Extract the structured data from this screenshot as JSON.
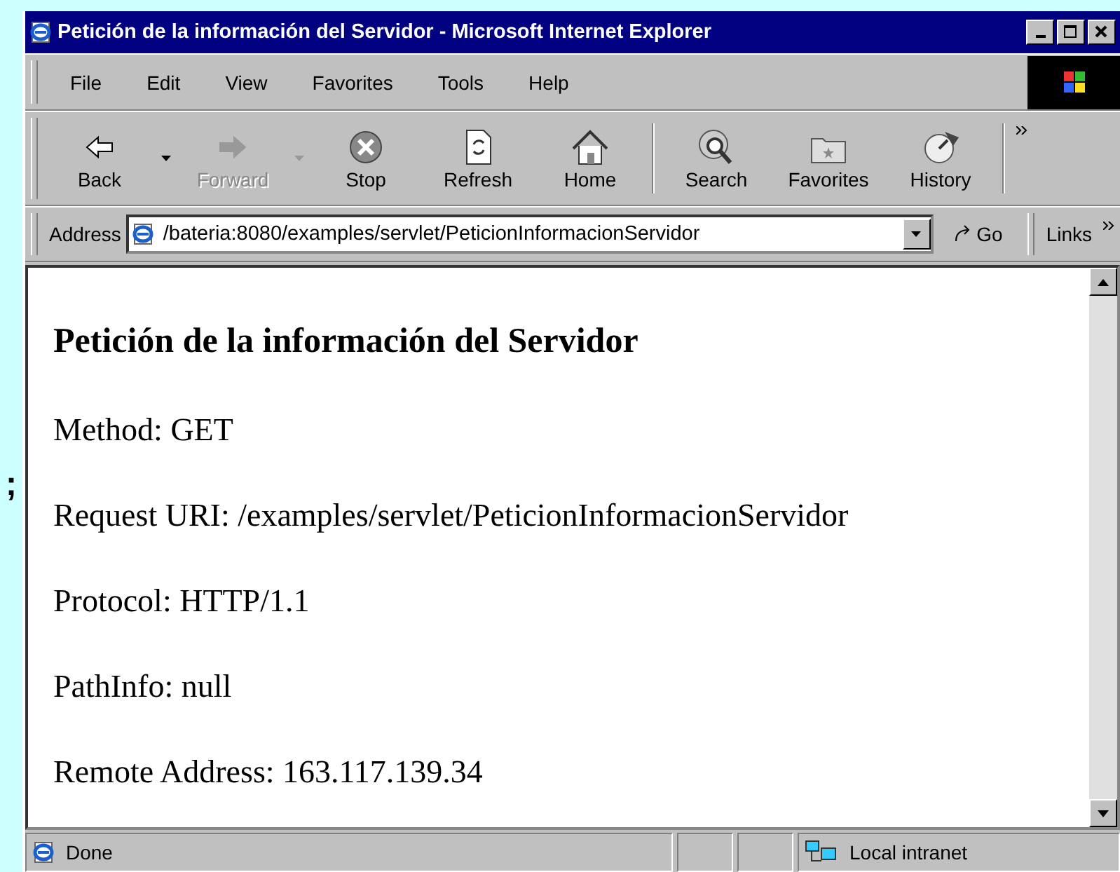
{
  "side_text": ";",
  "window": {
    "title": "Petición de la información del Servidor - Microsoft Internet Explorer"
  },
  "menu": [
    {
      "label": "File"
    },
    {
      "label": "Edit"
    },
    {
      "label": "View"
    },
    {
      "label": "Favorites"
    },
    {
      "label": "Tools"
    },
    {
      "label": "Help"
    }
  ],
  "toolbar": [
    {
      "kind": "back",
      "label": "Back",
      "disabled": false,
      "dropdown": true
    },
    {
      "kind": "forward",
      "label": "Forward",
      "disabled": true,
      "dropdown": true
    },
    {
      "kind": "stop",
      "label": "Stop",
      "disabled": false,
      "dropdown": false
    },
    {
      "kind": "refresh",
      "label": "Refresh",
      "disabled": false,
      "dropdown": false
    },
    {
      "kind": "home",
      "label": "Home",
      "disabled": false,
      "dropdown": false
    },
    {
      "kind": "separator"
    },
    {
      "kind": "search",
      "label": "Search",
      "disabled": false,
      "dropdown": false
    },
    {
      "kind": "favorites",
      "label": "Favorites",
      "disabled": false,
      "dropdown": false
    },
    {
      "kind": "history",
      "label": "History",
      "disabled": false,
      "dropdown": false
    }
  ],
  "address_bar": {
    "label": "Address",
    "url": "/bateria:8080/examples/servlet/PeticionInformacionServidor",
    "go": "Go",
    "links": "Links"
  },
  "page": {
    "heading": "Petición de la información del Servidor",
    "lines": [
      "Method: GET",
      "Request URI: /examples/servlet/PeticionInformacionServidor",
      "Protocol: HTTP/1.1",
      "PathInfo: null",
      "Remote Address: 163.117.139.34"
    ]
  },
  "status_bar": {
    "text": "Done",
    "zone": "Local intranet"
  }
}
